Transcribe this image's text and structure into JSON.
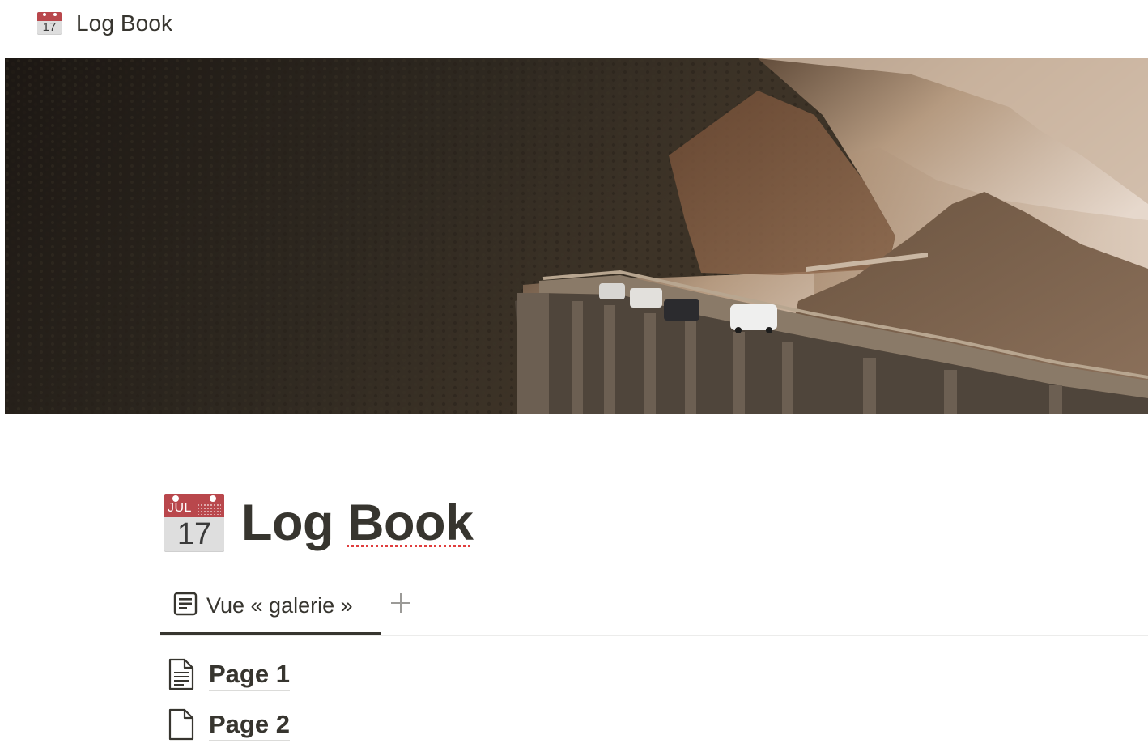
{
  "breadcrumb": {
    "icon": "calendar-icon",
    "title": "Log Book",
    "icon_day": "17"
  },
  "cover": {
    "description_icon": "cover-image"
  },
  "page": {
    "icon": "calendar-icon",
    "icon_month": "JUL",
    "icon_day": "17",
    "title_word1": "Log",
    "title_word2": "Book"
  },
  "views": {
    "tabs": [
      {
        "label": "Vue « galerie »",
        "icon": "gallery-view-icon",
        "active": true
      }
    ],
    "add_icon": "plus-icon"
  },
  "items": [
    {
      "label": "Page 1",
      "icon": "document-text-icon"
    },
    {
      "label": "Page 2",
      "icon": "document-blank-icon"
    }
  ],
  "colors": {
    "text": "#37352f",
    "calendar_red": "#b9474c",
    "spellcheck_underline": "#e03e3e",
    "divider": "#ececeb"
  }
}
